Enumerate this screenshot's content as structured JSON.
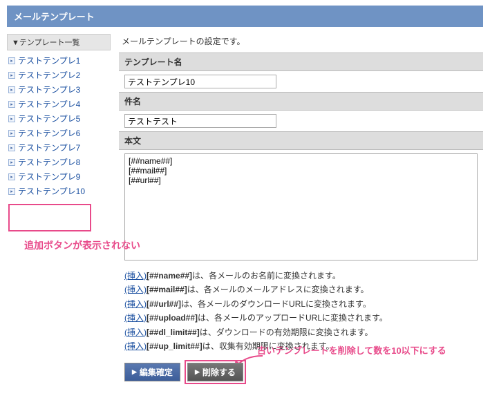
{
  "title": "メールテンプレート",
  "sidebar": {
    "heading": "▼テンプレート一覧",
    "items": [
      {
        "label": "テストテンプレ1"
      },
      {
        "label": "テストテンプレ2"
      },
      {
        "label": "テストテンプレ3"
      },
      {
        "label": "テストテンプレ4"
      },
      {
        "label": "テストテンプレ5"
      },
      {
        "label": "テストテンプレ6"
      },
      {
        "label": "テストテンプレ7"
      },
      {
        "label": "テストテンプレ8"
      },
      {
        "label": "テストテンプレ9"
      },
      {
        "label": "テストテンプレ10"
      }
    ]
  },
  "annotation1": "追加ボタンが表示されない",
  "main": {
    "description": "メールテンプレートの設定です。",
    "name_heading": "テンプレート名",
    "name_value": "テストテンプレ10",
    "subject_heading": "件名",
    "subject_value": "テストテスト",
    "body_heading": "本文",
    "body_value": "[##name##]\n[##mail##]\n[##url##]"
  },
  "hints": {
    "insert_label": "(挿入)",
    "rows": [
      {
        "ph": "[##name##]",
        "desc": "は、各メールのお名前に変換されます。"
      },
      {
        "ph": "[##mail##]",
        "desc": "は、各メールのメールアドレスに変換されます。"
      },
      {
        "ph": "[##url##]",
        "desc": "は、各メールのダウンロードURLに変換されます。"
      },
      {
        "ph": "[##upload##]",
        "desc": "は、各メールのアップロードURLに変換されます。"
      },
      {
        "ph": "[##dl_limit##]",
        "desc": "は、ダウンロードの有効期限に変換されます。"
      },
      {
        "ph": "[##up_limit##]",
        "desc": "は、収集有効期限に変換されます。"
      }
    ]
  },
  "buttons": {
    "confirm": "編集確定",
    "delete": "削除する"
  },
  "annotation2": "古いテンプレートを削除して数を10以下にする"
}
